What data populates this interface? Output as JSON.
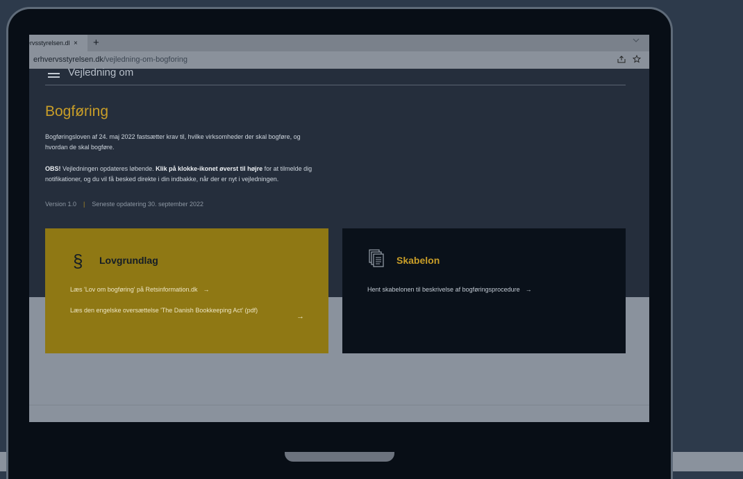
{
  "browser": {
    "tab_title": "ervsstyrelsen.dk",
    "tab_close": "×",
    "new_tab": "+",
    "url_domain": "erhvervsstyrelsen.dk",
    "url_path": "/vejledning-om-bogforing"
  },
  "page": {
    "menu_title": "Vejledning om",
    "title": "Bogføring",
    "intro": "Bogføringsloven af 24. maj 2022 fastsætter krav til, hvilke virksomheder der skal bogføre, og hvordan de skal bogføre.",
    "notice_label": "OBS!",
    "notice_text1": " Vejledningen opdateres løbende. ",
    "notice_bold": "Klik på klokke-ikonet øverst til højre",
    "notice_text2": " for at tilmelde dig notifikationer, og du vil få besked direkte i din indbakke, når der er nyt i vejledningen.",
    "version": "Version 1.0",
    "meta_separator": "|",
    "last_updated": "Seneste opdatering 30. september 2022"
  },
  "cards": {
    "lovgrundlag": {
      "title": "Lovgrundlag",
      "icon": "§",
      "link1": "Læs 'Lov om bogføring' på Retsinformation.dk",
      "link2": "Læs den engelske oversættelse 'The Danish Bookkeeping Act' (pdf)"
    },
    "skabelon": {
      "title": "Skabelon",
      "link1": "Hent skabelonen til beskrivelse af bogføringsprocedure"
    },
    "arrow": "→"
  },
  "colors": {
    "accent": "#c99e28",
    "hero_bg": "#252e3c",
    "card_yellow": "#8f7814",
    "card_dark": "#0a111a"
  }
}
